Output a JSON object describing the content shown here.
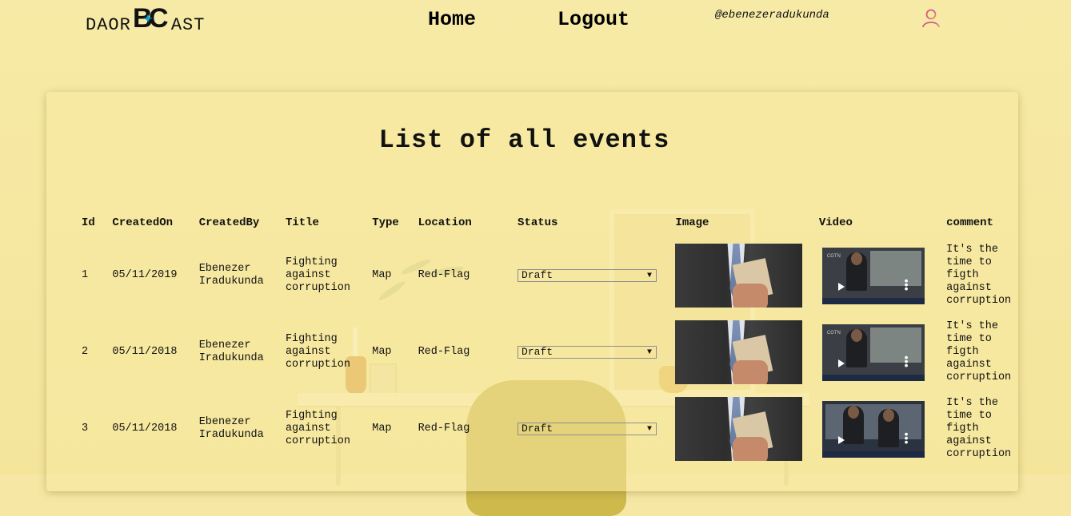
{
  "nav": {
    "logo_left": "DAOR",
    "logo_right": "AST",
    "home_label": "Home",
    "logout_label": "Logout",
    "username": "@ebenezeradukunda"
  },
  "page": {
    "title": "List of all events"
  },
  "table": {
    "headers": [
      "Id",
      "CreatedOn",
      "CreatedBy",
      "Title",
      "Type",
      "Location",
      "Status",
      "Image",
      "Video",
      "comment"
    ],
    "rows": [
      {
        "id": "1",
        "created_on": "05/11/2019",
        "created_by": "Ebenezer\nIradukunda",
        "title": "Fighting\nagainst\ncorruption",
        "type": "Map",
        "location": "Red-Flag",
        "status": "Draft",
        "comment": "It's the\ntime to\nfigth\nagainst\ncorruption"
      },
      {
        "id": "2",
        "created_on": "05/11/2018",
        "created_by": "Ebenezer\nIradukunda",
        "title": "Fighting\nagainst\ncorruption",
        "type": "Map",
        "location": "Red-Flag",
        "status": "Draft",
        "comment": "It's the\ntime to\nfigth\nagainst\ncorruption"
      },
      {
        "id": "3",
        "created_on": "05/11/2018",
        "created_by": "Ebenezer\nIradukunda",
        "title": "Fighting\nagainst\ncorruption",
        "type": "Map",
        "location": "Red-Flag",
        "status": "Draft",
        "comment": "It's the\ntime to\nfigth\nagainst\ncorruption"
      }
    ]
  },
  "icons": {
    "avatar": "user-icon",
    "play": "play-icon",
    "menu": "more-vertical-icon"
  },
  "colors": {
    "background": "#f6e8a4",
    "logo_accent": "#00a8d6"
  }
}
